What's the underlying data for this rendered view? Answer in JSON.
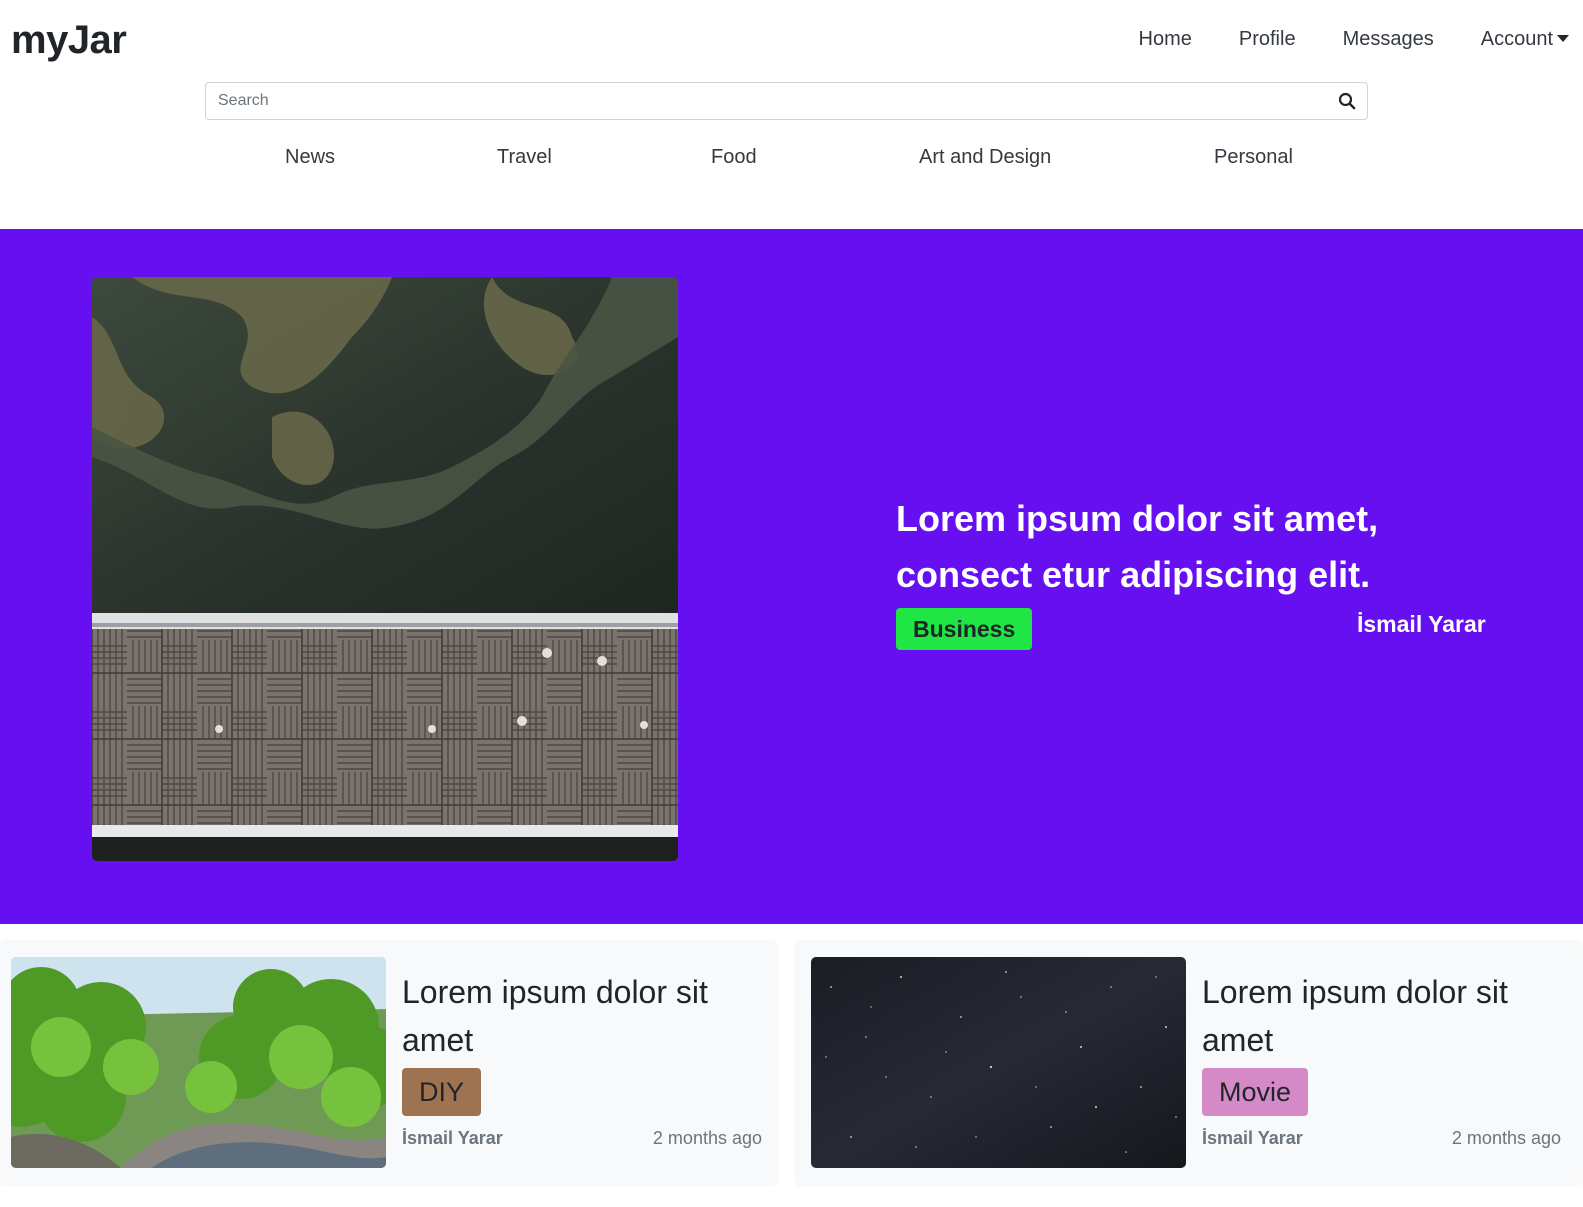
{
  "header": {
    "brand": "myJar",
    "nav": [
      "Home",
      "Profile",
      "Messages",
      "Account"
    ]
  },
  "search": {
    "placeholder": "Search"
  },
  "categories": [
    "News",
    "Travel",
    "Food",
    "Art and Design",
    "Personal"
  ],
  "hero": {
    "title": "Lorem ipsum dolor sit amet, consect etur adipiscing elit.",
    "badge": "Business",
    "author": "İsmail Yarar",
    "background": "#6610f2",
    "badge_color": "#20e645"
  },
  "cards": [
    {
      "title": "Lorem ipsum dolor sit amet",
      "badge": "DIY",
      "badge_color": "#9e7352",
      "author": "İsmail Yarar",
      "time": "2 months ago"
    },
    {
      "title": "Lorem ipsum dolor sit amet",
      "badge": "Movie",
      "badge_color": "#d48ac7",
      "author": "İsmail Yarar",
      "time": "2 months ago"
    }
  ],
  "icons": {
    "search": "search-icon",
    "caret": "caret-down-icon"
  }
}
